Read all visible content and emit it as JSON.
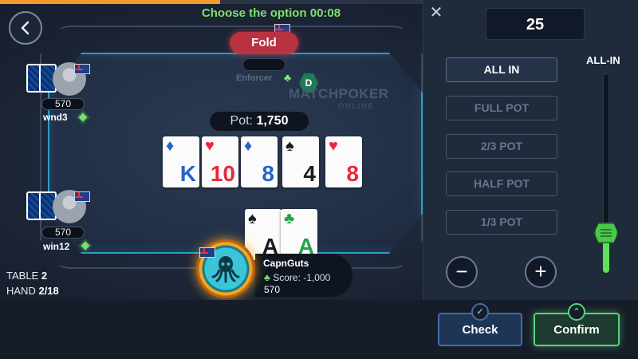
{
  "timer": {
    "text": "Choose the option 00:08",
    "progress": 0.52,
    "color": "#f39a2a"
  },
  "opponent_top": {
    "action": "Fold",
    "name": "Enforcer",
    "dealer_label": "D"
  },
  "watermark": {
    "main": "MATCHPOKER",
    "sub": "ONLINE"
  },
  "players": [
    {
      "name": "wnd3",
      "stack": "570"
    },
    {
      "name": "win12",
      "stack": "570"
    }
  ],
  "pot": {
    "label": "Pot:",
    "value": "1,750"
  },
  "board": [
    {
      "suit": "♦",
      "rank": "K",
      "color": "blue"
    },
    {
      "suit": "♥",
      "rank": "10",
      "color": "red"
    },
    {
      "suit": "♦",
      "rank": "8",
      "color": "blue"
    },
    {
      "suit": "♠",
      "rank": "4",
      "color": "black"
    },
    {
      "suit": "♥",
      "rank": "8",
      "color": "red"
    }
  ],
  "hero": {
    "name": "CapnGuts",
    "score_label": "Score: -1,000",
    "stack": "570",
    "cards": [
      {
        "suit": "♠",
        "rank": "A",
        "color": "black"
      },
      {
        "suit": "♣",
        "rank": "A",
        "color": "green"
      }
    ]
  },
  "table_info": {
    "table_label": "TABLE",
    "table_value": "2",
    "hand_label": "HAND",
    "hand_value": "2/18"
  },
  "actions": {
    "check": "Check",
    "confirm": "Confirm"
  },
  "raise_panel": {
    "close": "✕",
    "amount": "25",
    "options": [
      "ALL IN",
      "FULL POT",
      "2/3 POT",
      "HALF POT",
      "1/3 POT"
    ],
    "active_option": "ALL IN",
    "minus": "−",
    "plus": "+",
    "slider_label": "ALL-IN",
    "slider_level": 0.2
  }
}
